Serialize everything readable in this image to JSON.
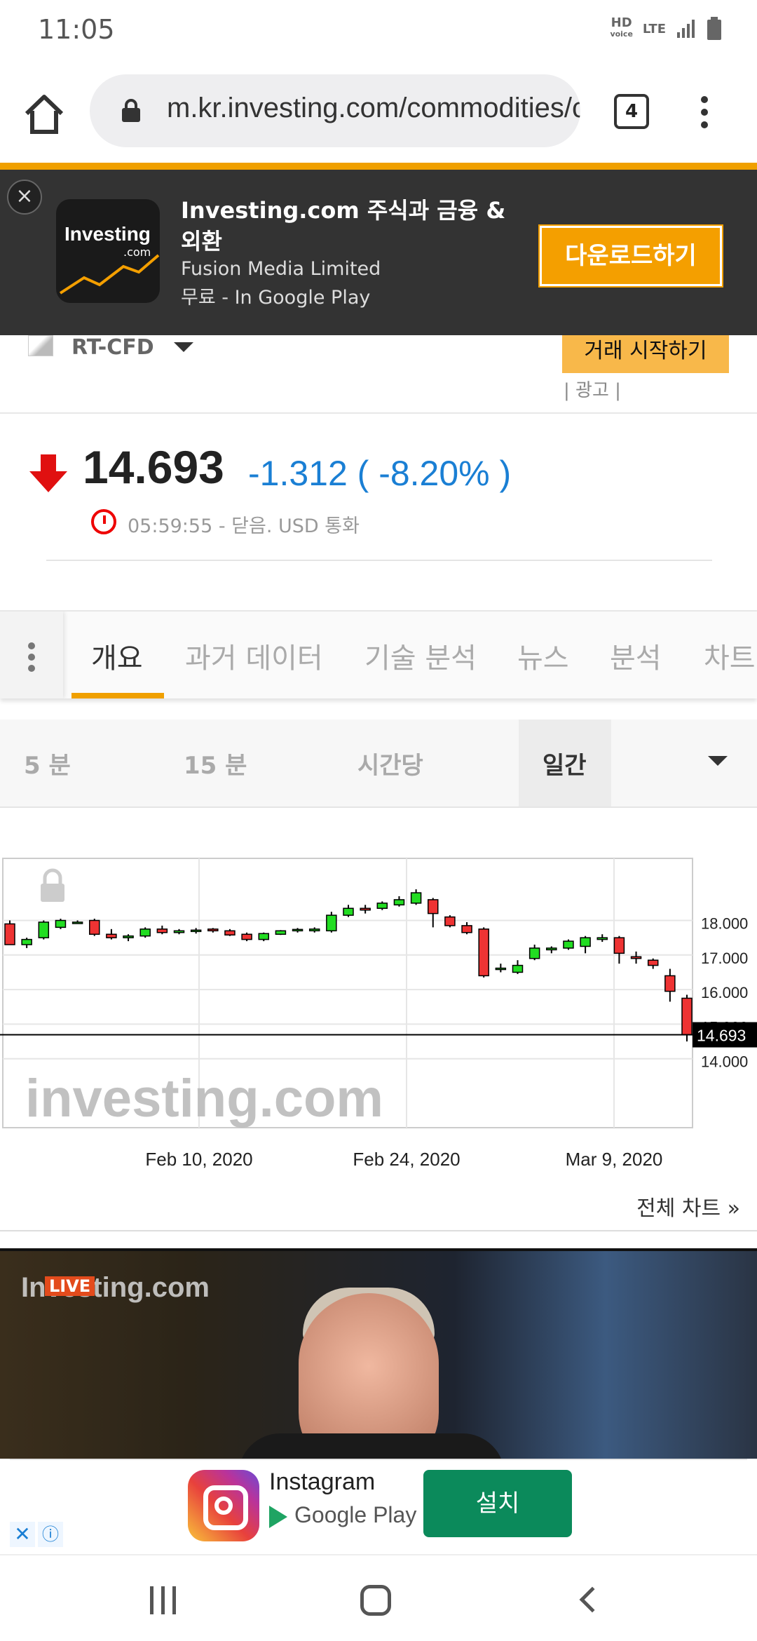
{
  "status_bar": {
    "time": "11:05",
    "hd": "HD",
    "voice": "voice",
    "lte": "LTE"
  },
  "browser": {
    "url": "m.kr.investing.com/commodities/crude-oil",
    "tab_count": "4"
  },
  "app_banner": {
    "title": "Investing.com 주식과 금융 & 외환",
    "publisher": "Fusion Media Limited",
    "price": "무료 - In Google Play",
    "download": "다운로드하기",
    "logo_text": "Investing",
    "logo_sub": ".com"
  },
  "instrument": {
    "source": "RT-CFD",
    "trade_button": "거래 시작하기",
    "ad_label": "| 광고 |"
  },
  "quote": {
    "last": "14.693",
    "change": "-1.312 ( -8.20% )",
    "status": "05:59:55 - 닫음. USD 통화"
  },
  "tabs": [
    "개요",
    "과거 데이터",
    "기술 분석",
    "뉴스",
    "분석",
    "차트"
  ],
  "periods": {
    "p1": "5 분",
    "p2": "15 분",
    "p3": "시간당",
    "p4": "일간"
  },
  "chart_data": {
    "type": "candlestick",
    "x_tick_labels": [
      "Feb 10, 2020",
      "Feb 24, 2020",
      "Mar 9, 2020"
    ],
    "y_tick_labels": [
      "18.000",
      "17.000",
      "16.000",
      "15.000",
      "14.000"
    ],
    "ylim": [
      14.0,
      18.6
    ],
    "last_price_label": "14.693",
    "watermark": "investing.com",
    "up_color": "#22dd22",
    "down_color": "#ee3333",
    "candles": [
      {
        "o": 17.9,
        "h": 18.0,
        "l": 17.3,
        "c": 17.3
      },
      {
        "o": 17.3,
        "h": 17.5,
        "l": 17.2,
        "c": 17.45
      },
      {
        "o": 17.5,
        "h": 18.0,
        "l": 17.45,
        "c": 17.95
      },
      {
        "o": 17.8,
        "h": 18.05,
        "l": 17.75,
        "c": 18.0
      },
      {
        "o": 17.95,
        "h": 18.0,
        "l": 17.9,
        "c": 17.95
      },
      {
        "o": 18.0,
        "h": 18.05,
        "l": 17.55,
        "c": 17.6
      },
      {
        "o": 17.6,
        "h": 17.75,
        "l": 17.45,
        "c": 17.5
      },
      {
        "o": 17.5,
        "h": 17.6,
        "l": 17.4,
        "c": 17.55
      },
      {
        "o": 17.55,
        "h": 17.8,
        "l": 17.5,
        "c": 17.75
      },
      {
        "o": 17.75,
        "h": 17.85,
        "l": 17.6,
        "c": 17.65
      },
      {
        "o": 17.65,
        "h": 17.75,
        "l": 17.6,
        "c": 17.7
      },
      {
        "o": 17.7,
        "h": 17.78,
        "l": 17.62,
        "c": 17.72
      },
      {
        "o": 17.75,
        "h": 17.78,
        "l": 17.65,
        "c": 17.7
      },
      {
        "o": 17.7,
        "h": 17.75,
        "l": 17.55,
        "c": 17.58
      },
      {
        "o": 17.6,
        "h": 17.65,
        "l": 17.4,
        "c": 17.45
      },
      {
        "o": 17.45,
        "h": 17.65,
        "l": 17.4,
        "c": 17.62
      },
      {
        "o": 17.6,
        "h": 17.72,
        "l": 17.58,
        "c": 17.7
      },
      {
        "o": 17.7,
        "h": 17.78,
        "l": 17.65,
        "c": 17.74
      },
      {
        "o": 17.7,
        "h": 17.8,
        "l": 17.65,
        "c": 17.75
      },
      {
        "o": 17.7,
        "h": 18.25,
        "l": 17.65,
        "c": 18.15
      },
      {
        "o": 18.15,
        "h": 18.45,
        "l": 18.1,
        "c": 18.35
      },
      {
        "o": 18.35,
        "h": 18.45,
        "l": 18.2,
        "c": 18.3
      },
      {
        "o": 18.35,
        "h": 18.55,
        "l": 18.3,
        "c": 18.5
      },
      {
        "o": 18.45,
        "h": 18.7,
        "l": 18.4,
        "c": 18.6
      },
      {
        "o": 18.5,
        "h": 18.9,
        "l": 18.45,
        "c": 18.8
      },
      {
        "o": 18.6,
        "h": 18.65,
        "l": 17.8,
        "c": 18.2
      },
      {
        "o": 18.1,
        "h": 18.15,
        "l": 17.8,
        "c": 17.85
      },
      {
        "o": 17.85,
        "h": 17.95,
        "l": 17.6,
        "c": 17.65
      },
      {
        "o": 17.75,
        "h": 17.8,
        "l": 16.35,
        "c": 16.4
      },
      {
        "o": 16.6,
        "h": 16.75,
        "l": 16.5,
        "c": 16.62
      },
      {
        "o": 16.5,
        "h": 16.85,
        "l": 16.45,
        "c": 16.7
      },
      {
        "o": 16.9,
        "h": 17.3,
        "l": 16.85,
        "c": 17.2
      },
      {
        "o": 17.15,
        "h": 17.25,
        "l": 17.05,
        "c": 17.2
      },
      {
        "o": 17.2,
        "h": 17.45,
        "l": 17.15,
        "c": 17.4
      },
      {
        "o": 17.25,
        "h": 17.55,
        "l": 17.05,
        "c": 17.5
      },
      {
        "o": 17.45,
        "h": 17.6,
        "l": 17.38,
        "c": 17.5
      },
      {
        "o": 17.5,
        "h": 17.55,
        "l": 16.75,
        "c": 17.05
      },
      {
        "o": 16.95,
        "h": 17.1,
        "l": 16.75,
        "c": 16.9
      },
      {
        "o": 16.85,
        "h": 16.9,
        "l": 16.6,
        "c": 16.7
      },
      {
        "o": 16.4,
        "h": 16.6,
        "l": 15.65,
        "c": 15.95
      },
      {
        "o": 15.75,
        "h": 15.85,
        "l": 14.5,
        "c": 14.69
      }
    ]
  },
  "full_chart_link": "전체 차트 »",
  "video": {
    "watermark": "Investing.com",
    "live": "LIVE"
  },
  "ad": {
    "app": "Instagram",
    "store": "Google Play",
    "install": "설치",
    "close": "✕",
    "info": "ⓘ"
  }
}
